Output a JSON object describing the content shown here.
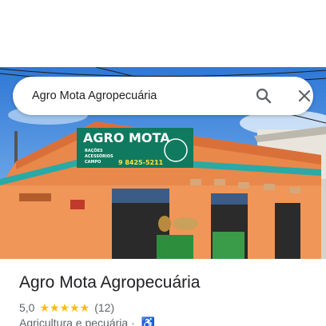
{
  "search": {
    "query": "Agro Mota Agropecuária"
  },
  "photo": {
    "sign_title": "AGRO MOTA",
    "sign_items": [
      "RAÇÕES",
      "ACESSÓRIOS",
      "CAMPO"
    ],
    "sign_phone": "9 8425-5211"
  },
  "place": {
    "title": "Agro Mota Agropecuária",
    "rating": "5,0",
    "stars": "★★★★★",
    "review_count": "(12)",
    "category": "Agricultura e pecuária ·"
  },
  "icons": {
    "search": "search-icon",
    "close": "close-icon",
    "accessibility": "wheelchair-accessible-icon"
  },
  "colors": {
    "accent": "#1a73e8",
    "stars": "#fbbc04"
  }
}
